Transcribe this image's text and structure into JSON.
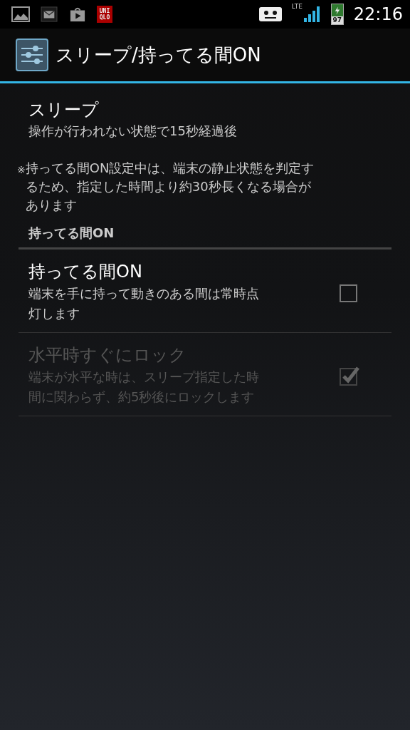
{
  "status_bar": {
    "notification_logo_text": [
      "UNI",
      "QLO"
    ],
    "network": "LTE",
    "battery": "97",
    "time": "22:16"
  },
  "action_bar": {
    "title": "スリープ/持ってる間ON"
  },
  "sleep": {
    "title": "スリープ",
    "summary": "操作が行われない状態で15秒経過後"
  },
  "note": {
    "mark": "※",
    "lines": [
      "持ってる間ON設定中は、端末の静止状態を判定す",
      "るため、指定した時間より約30秒長くなる場合が",
      "あります"
    ]
  },
  "category": {
    "title": "持ってる間ON"
  },
  "items": [
    {
      "title": "持ってる間ON",
      "summary_lines": [
        "端末を手に持って動きのある間は常時点",
        "灯します"
      ],
      "checked": false,
      "disabled": false
    },
    {
      "title": "水平時すぐにロック",
      "summary_lines": [
        "端末が水平な時は、スリープ指定した時",
        "間に関わらず、約5秒後にロックします"
      ],
      "checked": true,
      "disabled": true
    }
  ]
}
